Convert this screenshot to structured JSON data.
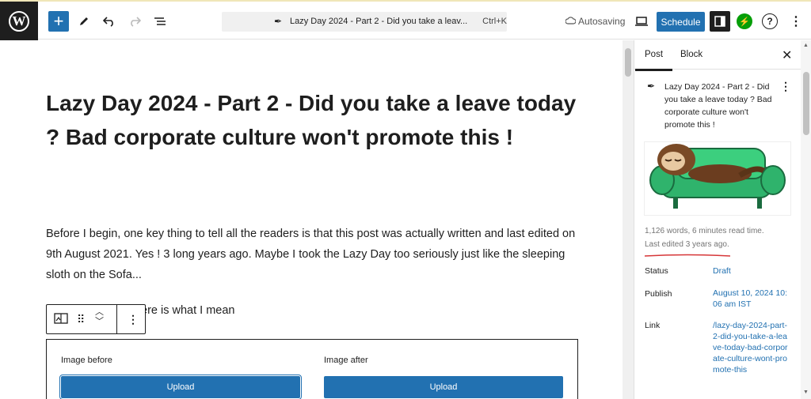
{
  "topbar": {
    "logo_letter": "W",
    "add_icon": "+",
    "command_title": "Lazy Day 2024 - Part 2 - Did you take a leav...",
    "command_shortcut": "Ctrl+K",
    "autosave_text": "Autosaving",
    "schedule_label": "Schedule",
    "help_icon": "?"
  },
  "editor": {
    "title": "Lazy Day 2024 - Part 2 - Did you take a leave today ? Bad corporate culture won't promote this !",
    "paragraph": "Before I begin, one key thing to tell all the readers is that this post was actually written and last edited on 9th August 2021. Yes ! 3 long years ago. Maybe I took the Lazy Day too seriously just like the sleeping sloth on the Sofa...",
    "partial_paragraph": "ere is what I mean",
    "compare": {
      "before_label": "Image before",
      "after_label": "Image after",
      "upload_label": "Upload"
    }
  },
  "sidebar": {
    "tabs": [
      "Post",
      "Block"
    ],
    "post_title": "Lazy Day 2024 - Part 2 - Did you take a leave today ? Bad corporate culture won't promote this !",
    "stats": "1,126 words, 6 minutes read time.",
    "last_edited": "Last edited 3 years ago.",
    "rows": {
      "status_label": "Status",
      "status_value": "Draft",
      "publish_label": "Publish",
      "publish_value": "August 10, 2024 10:06 am IST",
      "link_label": "Link",
      "link_value": "/lazy-day-2024-part-2-did-you-take-a-leave-today-bad-corporate-culture-wont-promote-this"
    }
  },
  "colors": {
    "accent": "#2271b1",
    "jetpack": "#069e08",
    "underline": "#d63638"
  }
}
